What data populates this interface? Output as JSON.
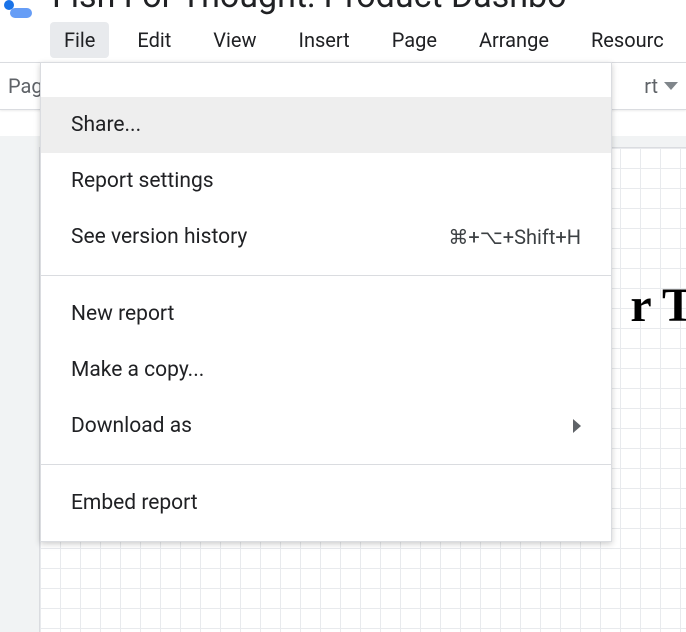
{
  "doc_title": "Fish For Thought: Product Dashbo",
  "menubar": {
    "file": "File",
    "edit": "Edit",
    "view": "View",
    "insert": "Insert",
    "page": "Page",
    "arrange": "Arrange",
    "resource": "Resourc"
  },
  "toolbar": {
    "page_label": "Page",
    "right_fragment": "rt"
  },
  "dropdown": {
    "share": "Share...",
    "report_settings": "Report settings",
    "version_history": {
      "label": "See version history",
      "shortcut": "⌘+⌥+Shift+H"
    },
    "new_report": "New report",
    "make_copy": "Make a copy...",
    "download_as": "Download as",
    "embed_report": "Embed report"
  },
  "canvas": {
    "partial_text": "r T"
  }
}
